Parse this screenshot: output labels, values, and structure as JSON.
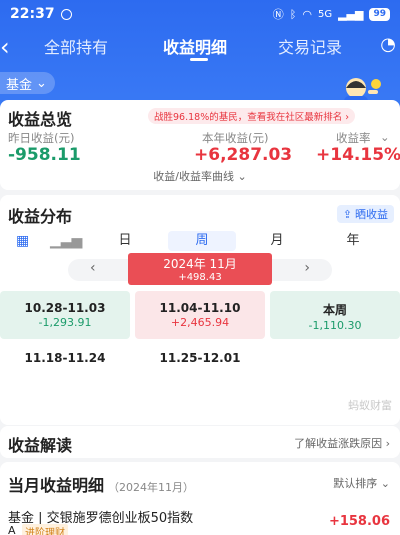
{
  "status": {
    "time": "22:37",
    "signal": "5G",
    "battery": "99"
  },
  "nav": {
    "tabs": [
      {
        "label": "全部持有"
      },
      {
        "label": "收益明细"
      },
      {
        "label": "交易记录"
      }
    ]
  },
  "fund_filter": {
    "label": "基金"
  },
  "summary": {
    "title": "收益总览",
    "rank_banner": "战胜96.18%的基民，查看我在社区最新排名 ›",
    "yesterday_label": "昨日收益(元)",
    "yesterday_value": "-958.11",
    "year_label": "本年收益(元)",
    "year_value": "+6,287.03",
    "rate_label": "收益率",
    "rate_value": "+14.15%",
    "curve_link": "收益/收益率曲线"
  },
  "distribution": {
    "title": "收益分布",
    "share_button": "晒收益",
    "periods": [
      "日",
      "周",
      "月",
      "年"
    ],
    "month": {
      "title": "2024年 11月",
      "value": "+498.43"
    },
    "weeks": [
      {
        "range": "10.28-11.03",
        "value": "-1,293.91"
      },
      {
        "range": "11.04-11.10",
        "value": "+2,465.94"
      },
      {
        "range": "本周",
        "value": "-1,110.30"
      },
      {
        "range": "11.18-11.24",
        "value": ""
      },
      {
        "range": "11.25-12.01",
        "value": ""
      }
    ],
    "watermark": "蚂蚁财富"
  },
  "interpret": {
    "title": "收益解读",
    "link": "了解收益涨跌原因 ›"
  },
  "monthly": {
    "title": "当月收益明细",
    "subtitle": "（2024年11月）",
    "sort": "默认排序 ⌄",
    "fund_name": "基金 | 交银施罗德创业板50指数",
    "fund_class": "A",
    "fund_tag": "进阶理财",
    "fund_value": "+158.06"
  },
  "colors": {
    "brand": "#2d6bf0",
    "gain": "#e8353f",
    "loss": "#1b9b6a"
  }
}
